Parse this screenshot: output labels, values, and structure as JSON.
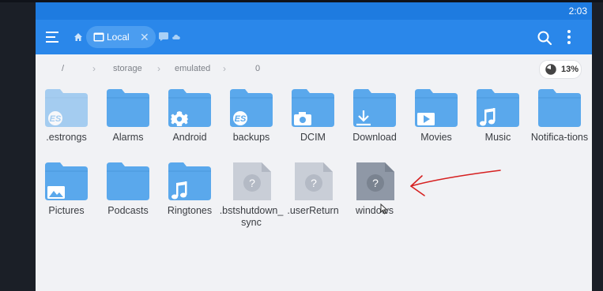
{
  "statusbar": {
    "time": "2:03"
  },
  "appbar": {
    "tab_label": "Local",
    "tab_close": "✕"
  },
  "breadcrumb": {
    "root": "/",
    "items": [
      "storage",
      "emulated",
      "0"
    ],
    "storage_percent": "13%"
  },
  "files": [
    {
      "name": ".estrongs",
      "type": "folder",
      "badge": "es-logo",
      "faded": true
    },
    {
      "name": "Alarms",
      "type": "folder",
      "badge": ""
    },
    {
      "name": "Android",
      "type": "folder",
      "badge": "gear-icon"
    },
    {
      "name": "backups",
      "type": "folder",
      "badge": "es-logo"
    },
    {
      "name": "DCIM",
      "type": "folder",
      "badge": "camera-icon"
    },
    {
      "name": "Download",
      "type": "folder",
      "badge": "download-icon"
    },
    {
      "name": "Movies",
      "type": "folder",
      "badge": "play-icon"
    },
    {
      "name": "Music",
      "type": "folder",
      "badge": "music-note-icon"
    },
    {
      "name": "Notifica-tions",
      "type": "folder",
      "badge": ""
    },
    {
      "name": "Pictures",
      "type": "folder",
      "badge": "image-icon"
    },
    {
      "name": "Podcasts",
      "type": "folder",
      "badge": ""
    },
    {
      "name": "Ringtones",
      "type": "folder",
      "badge": "music-note-icon"
    },
    {
      "name": ".bstshutdown_sync",
      "type": "unknown-file",
      "badge": "question-icon"
    },
    {
      "name": ".userReturn",
      "type": "unknown-file",
      "badge": "question-icon"
    },
    {
      "name": "windows",
      "type": "unknown-file",
      "badge": "question-icon",
      "selected": true
    }
  ],
  "colors": {
    "appbar": "#2a87ea",
    "statusbar": "#1e7be0",
    "folder": "#5aa8ec",
    "annotation_arrow": "#d62020"
  }
}
